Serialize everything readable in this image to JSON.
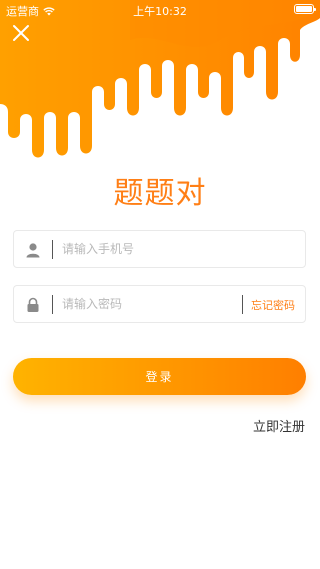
{
  "status_bar": {
    "carrier": "运营商",
    "time": "上午10:32"
  },
  "title": "题题对",
  "phone_field": {
    "placeholder": "请输入手机号"
  },
  "password_field": {
    "placeholder": "请输入密码",
    "forgot_label": "忘记密码"
  },
  "login_button": {
    "label": "登录"
  },
  "register_link": {
    "label": "立即注册"
  },
  "icons": {
    "close": "close-icon",
    "user": "user-icon",
    "lock": "lock-icon",
    "wifi": "wifi-icon",
    "battery": "battery-icon"
  },
  "colors": {
    "brand_start": "#ffb300",
    "brand_end": "#ff7f00",
    "title": "#ff7f16",
    "forgot": "#ff7f16",
    "icon_gray": "#8a8a8a"
  }
}
